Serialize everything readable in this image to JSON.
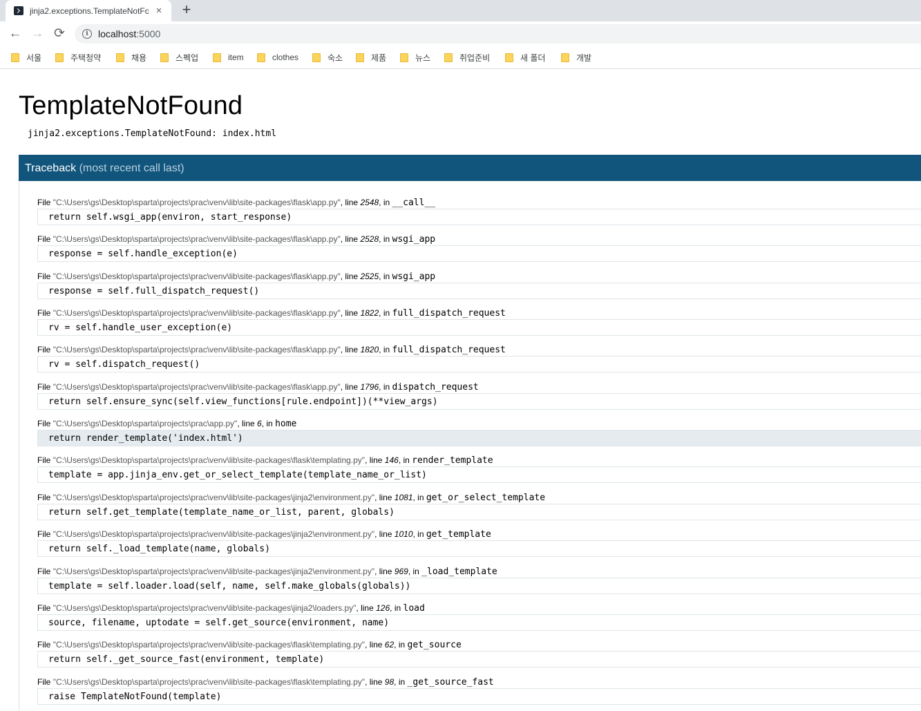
{
  "browser": {
    "tab": {
      "title": "jinja2.exceptions.TemplateNotFo",
      "close": "×"
    },
    "new_tab": "+",
    "nav": {
      "back": "←",
      "forward": "→",
      "reload": "⟳"
    },
    "url": {
      "host": "localhost",
      "port": ":5000"
    },
    "bookmarks": [
      "서울",
      "주택청약",
      "채용",
      "스펙업",
      "item",
      "clothes",
      "숙소",
      "제품",
      "뉴스",
      "취업준비",
      "새 폴더",
      "개발"
    ]
  },
  "error": {
    "title": "TemplateNotFound",
    "message": "jinja2.exceptions.TemplateNotFound: index.html"
  },
  "traceback": {
    "label": "Traceback",
    "sublabel": "(most recent call last)",
    "file_word": "File",
    "line_word": "line",
    "in_word": "in",
    "frames": [
      {
        "path": "\"C:\\Users\\gs\\Desktop\\sparta\\projects\\prac\\venv\\lib\\site-packages\\flask\\app.py\"",
        "line": "2548",
        "func": "__call__",
        "code": "return self.wsgi_app(environ, start_response)",
        "current": false
      },
      {
        "path": "\"C:\\Users\\gs\\Desktop\\sparta\\projects\\prac\\venv\\lib\\site-packages\\flask\\app.py\"",
        "line": "2528",
        "func": "wsgi_app",
        "code": "response = self.handle_exception(e)",
        "current": false
      },
      {
        "path": "\"C:\\Users\\gs\\Desktop\\sparta\\projects\\prac\\venv\\lib\\site-packages\\flask\\app.py\"",
        "line": "2525",
        "func": "wsgi_app",
        "code": "response = self.full_dispatch_request()",
        "current": false
      },
      {
        "path": "\"C:\\Users\\gs\\Desktop\\sparta\\projects\\prac\\venv\\lib\\site-packages\\flask\\app.py\"",
        "line": "1822",
        "func": "full_dispatch_request",
        "code": "rv = self.handle_user_exception(e)",
        "current": false
      },
      {
        "path": "\"C:\\Users\\gs\\Desktop\\sparta\\projects\\prac\\venv\\lib\\site-packages\\flask\\app.py\"",
        "line": "1820",
        "func": "full_dispatch_request",
        "code": "rv = self.dispatch_request()",
        "current": false
      },
      {
        "path": "\"C:\\Users\\gs\\Desktop\\sparta\\projects\\prac\\venv\\lib\\site-packages\\flask\\app.py\"",
        "line": "1796",
        "func": "dispatch_request",
        "code": "return self.ensure_sync(self.view_functions[rule.endpoint])(**view_args)",
        "current": false
      },
      {
        "path": "\"C:\\Users\\gs\\Desktop\\sparta\\projects\\prac\\app.py\"",
        "line": "6",
        "func": "home",
        "code": "return render_template('index.html')",
        "current": true
      },
      {
        "path": "\"C:\\Users\\gs\\Desktop\\sparta\\projects\\prac\\venv\\lib\\site-packages\\flask\\templating.py\"",
        "line": "146",
        "func": "render_template",
        "code": "template = app.jinja_env.get_or_select_template(template_name_or_list)",
        "current": false
      },
      {
        "path": "\"C:\\Users\\gs\\Desktop\\sparta\\projects\\prac\\venv\\lib\\site-packages\\jinja2\\environment.py\"",
        "line": "1081",
        "func": "get_or_select_template",
        "code": "return self.get_template(template_name_or_list, parent, globals)",
        "current": false
      },
      {
        "path": "\"C:\\Users\\gs\\Desktop\\sparta\\projects\\prac\\venv\\lib\\site-packages\\jinja2\\environment.py\"",
        "line": "1010",
        "func": "get_template",
        "code": "return self._load_template(name, globals)",
        "current": false
      },
      {
        "path": "\"C:\\Users\\gs\\Desktop\\sparta\\projects\\prac\\venv\\lib\\site-packages\\jinja2\\environment.py\"",
        "line": "969",
        "func": "_load_template",
        "code": "template = self.loader.load(self, name, self.make_globals(globals))",
        "current": false
      },
      {
        "path": "\"C:\\Users\\gs\\Desktop\\sparta\\projects\\prac\\venv\\lib\\site-packages\\jinja2\\loaders.py\"",
        "line": "126",
        "func": "load",
        "code": "source, filename, uptodate = self.get_source(environment, name)",
        "current": false
      },
      {
        "path": "\"C:\\Users\\gs\\Desktop\\sparta\\projects\\prac\\venv\\lib\\site-packages\\flask\\templating.py\"",
        "line": "62",
        "func": "get_source",
        "code": "return self._get_source_fast(environment, template)",
        "current": false
      },
      {
        "path": "\"C:\\Users\\gs\\Desktop\\sparta\\projects\\prac\\venv\\lib\\site-packages\\flask\\templating.py\"",
        "line": "98",
        "func": "_get_source_fast",
        "code": "raise TemplateNotFound(template)",
        "current": false
      }
    ]
  },
  "colors": {
    "traceback_header": "#11557c",
    "current_frame": "#e6ebef",
    "folder": "#fbd45c"
  }
}
